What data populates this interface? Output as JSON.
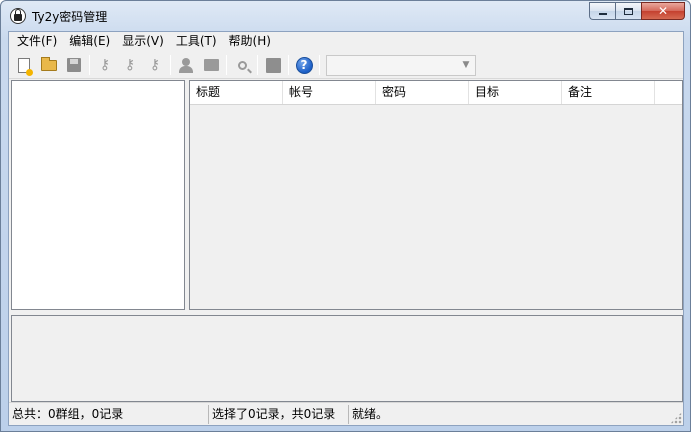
{
  "window": {
    "title": "Ty2y密码管理",
    "controls": [
      "minimize",
      "maximize",
      "close"
    ]
  },
  "menu": {
    "items": [
      {
        "label": "文件(F)"
      },
      {
        "label": "编辑(E)"
      },
      {
        "label": "显示(V)"
      },
      {
        "label": "工具(T)"
      },
      {
        "label": "帮助(H)"
      }
    ]
  },
  "toolbar": {
    "buttons": [
      {
        "icon": "new-document-icon",
        "enabled": true
      },
      {
        "icon": "open-folder-icon",
        "enabled": true
      },
      {
        "icon": "save-icon",
        "enabled": false
      },
      {
        "icon": "add-key-icon",
        "enabled": false
      },
      {
        "icon": "edit-key-icon",
        "enabled": false
      },
      {
        "icon": "delete-key-icon",
        "enabled": false
      },
      {
        "icon": "user-icon",
        "enabled": false
      },
      {
        "icon": "group-folder-icon",
        "enabled": false
      },
      {
        "icon": "search-icon",
        "enabled": false
      },
      {
        "icon": "stop-icon",
        "enabled": false
      },
      {
        "icon": "help-icon",
        "enabled": true
      }
    ],
    "search_combo_value": ""
  },
  "table": {
    "columns": [
      "标题",
      "帐号",
      "密码",
      "目标",
      "备注"
    ],
    "rows": []
  },
  "status": {
    "totals": "总共：0群组，0记录",
    "selection": "选择了0记录，共0记录",
    "state": "就绪。"
  }
}
